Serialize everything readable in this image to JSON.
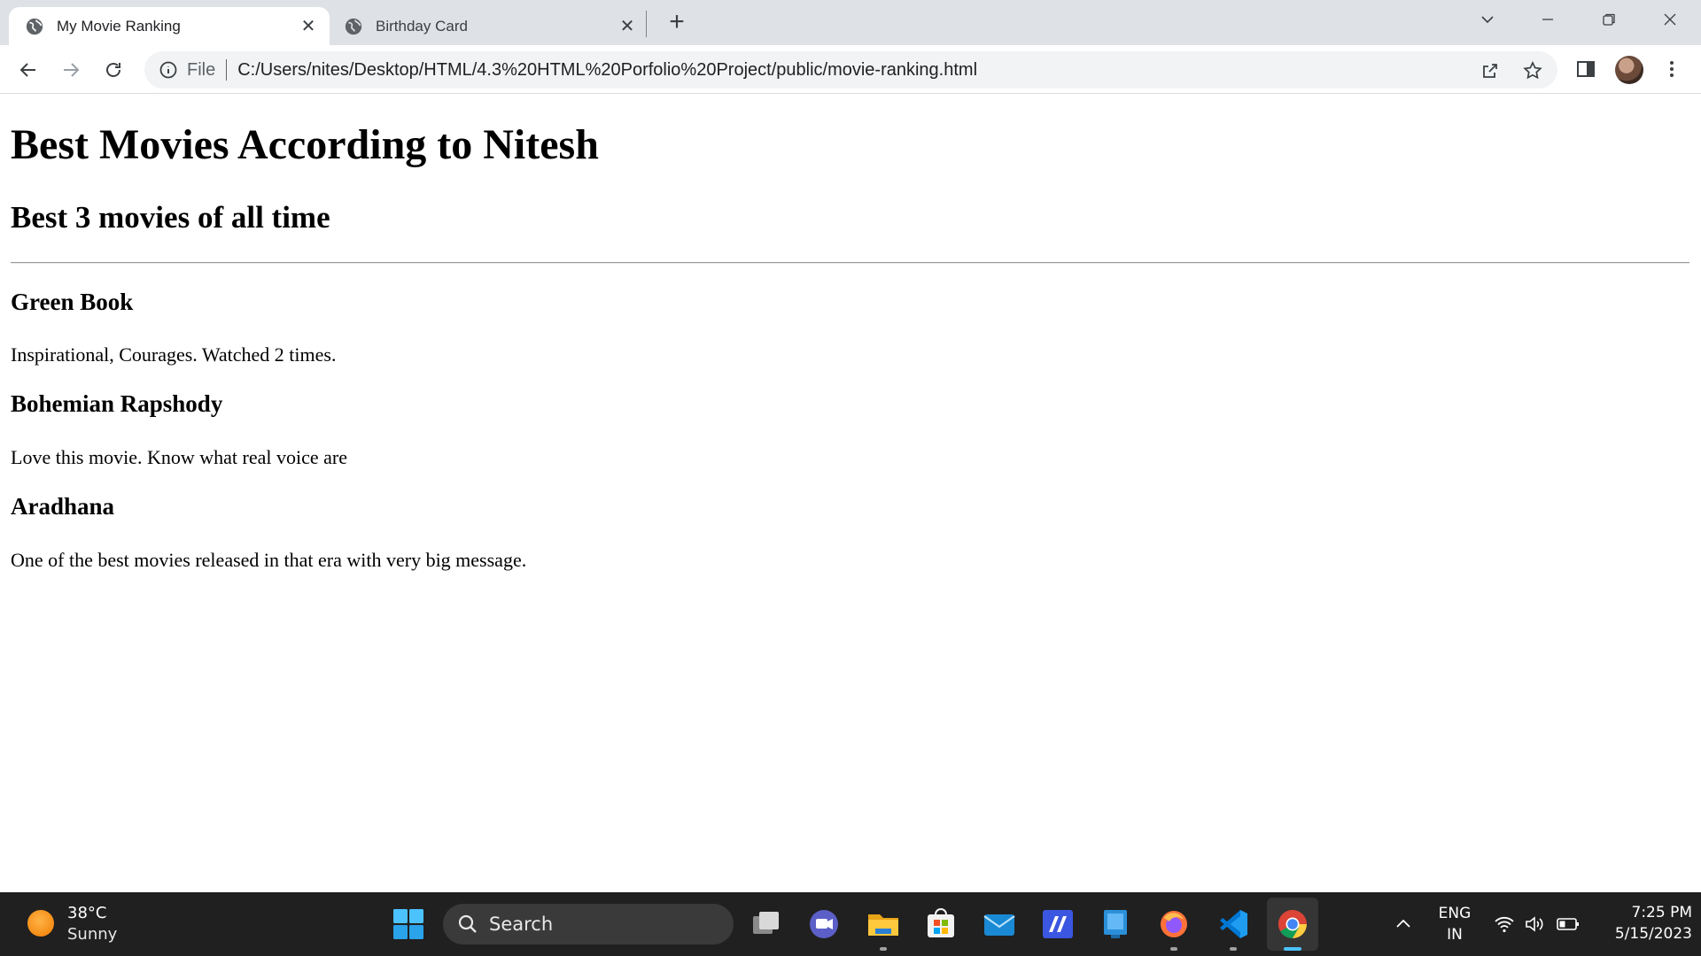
{
  "browser": {
    "tabs": [
      {
        "title": "My Movie Ranking",
        "active": true
      },
      {
        "title": "Birthday Card",
        "active": false
      }
    ],
    "address": {
      "scheme_label": "File",
      "url": "C:/Users/nites/Desktop/HTML/4.3%20HTML%20Porfolio%20Project/public/movie-ranking.html"
    }
  },
  "page": {
    "heading": "Best Movies According to Nitesh",
    "subheading": "Best 3 movies of all time",
    "movies": [
      {
        "title": "Green Book",
        "description": "Inspirational, Courages. Watched 2 times."
      },
      {
        "title": "Bohemian Rapshody",
        "description": "Love this movie. Know what real voice are"
      },
      {
        "title": "Aradhana",
        "description": "One of the best movies released in that era with very big message."
      }
    ]
  },
  "taskbar": {
    "weather": {
      "temp": "38°C",
      "condition": "Sunny"
    },
    "search_placeholder": "Search",
    "language": {
      "line1": "ENG",
      "line2": "IN"
    },
    "clock": {
      "time": "7:25 PM",
      "date": "5/15/2023"
    }
  },
  "colors": {
    "tabstrip": "#dee1e6",
    "omnibox": "#f1f3f4",
    "taskbar": "#202020",
    "accent": "#4cc2ff"
  }
}
